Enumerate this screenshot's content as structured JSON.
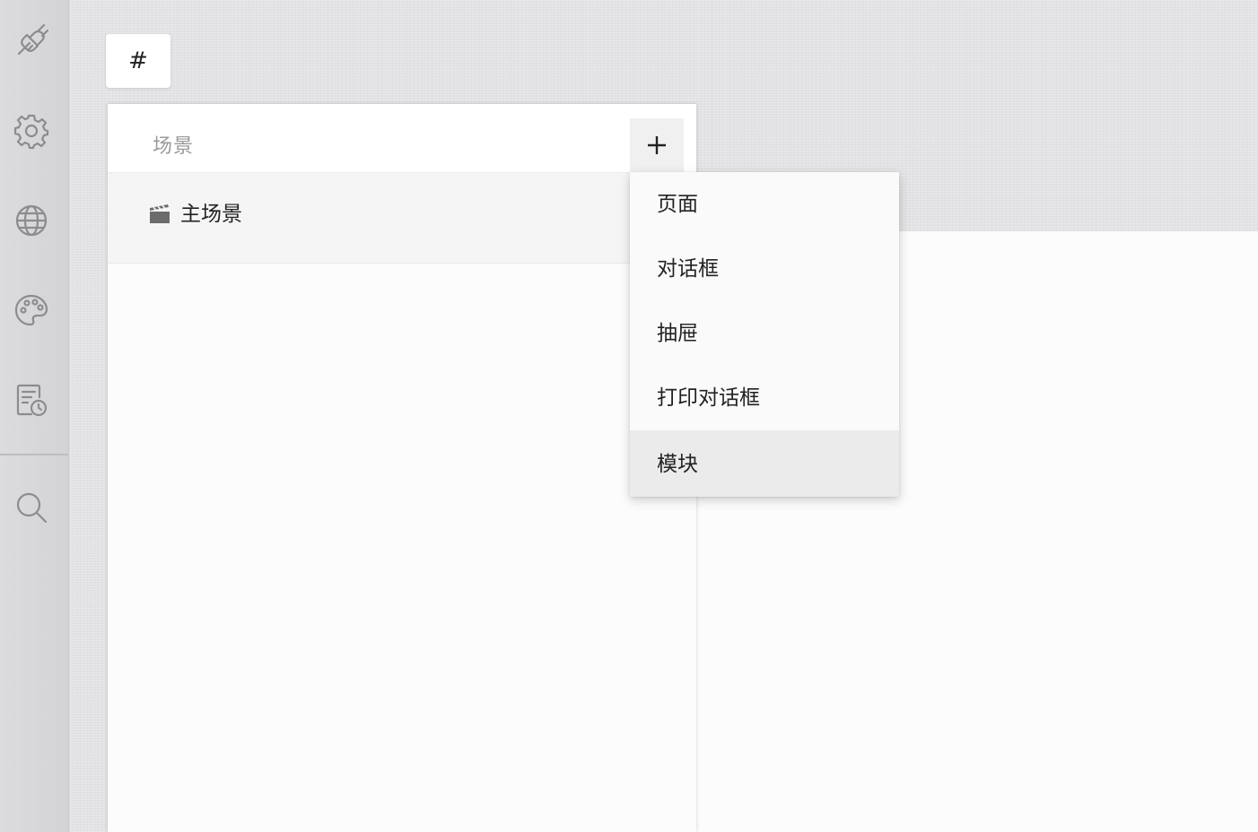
{
  "tab": {
    "label": "#"
  },
  "scenes": {
    "title": "场景",
    "add_label": "+",
    "items": [
      {
        "label": "主场景",
        "icon": "clapperboard-icon"
      }
    ]
  },
  "add_menu": {
    "items": [
      {
        "label": "页面",
        "active": false
      },
      {
        "label": "对话框",
        "active": false
      },
      {
        "label": "抽屉",
        "active": false
      },
      {
        "label": "打印对话框",
        "active": false
      },
      {
        "label": "模块",
        "active": true
      }
    ]
  },
  "sidebar": {
    "icons": [
      "plugin-icon",
      "gear-icon",
      "globe-icon",
      "palette-icon",
      "history-icon",
      "search-icon"
    ]
  },
  "colors": {
    "rail": "#d6d6d9",
    "panel": "#fcfcfc",
    "menu_active": "#ebebeb",
    "text": "#222222",
    "muted_text": "#9a9a9a"
  }
}
